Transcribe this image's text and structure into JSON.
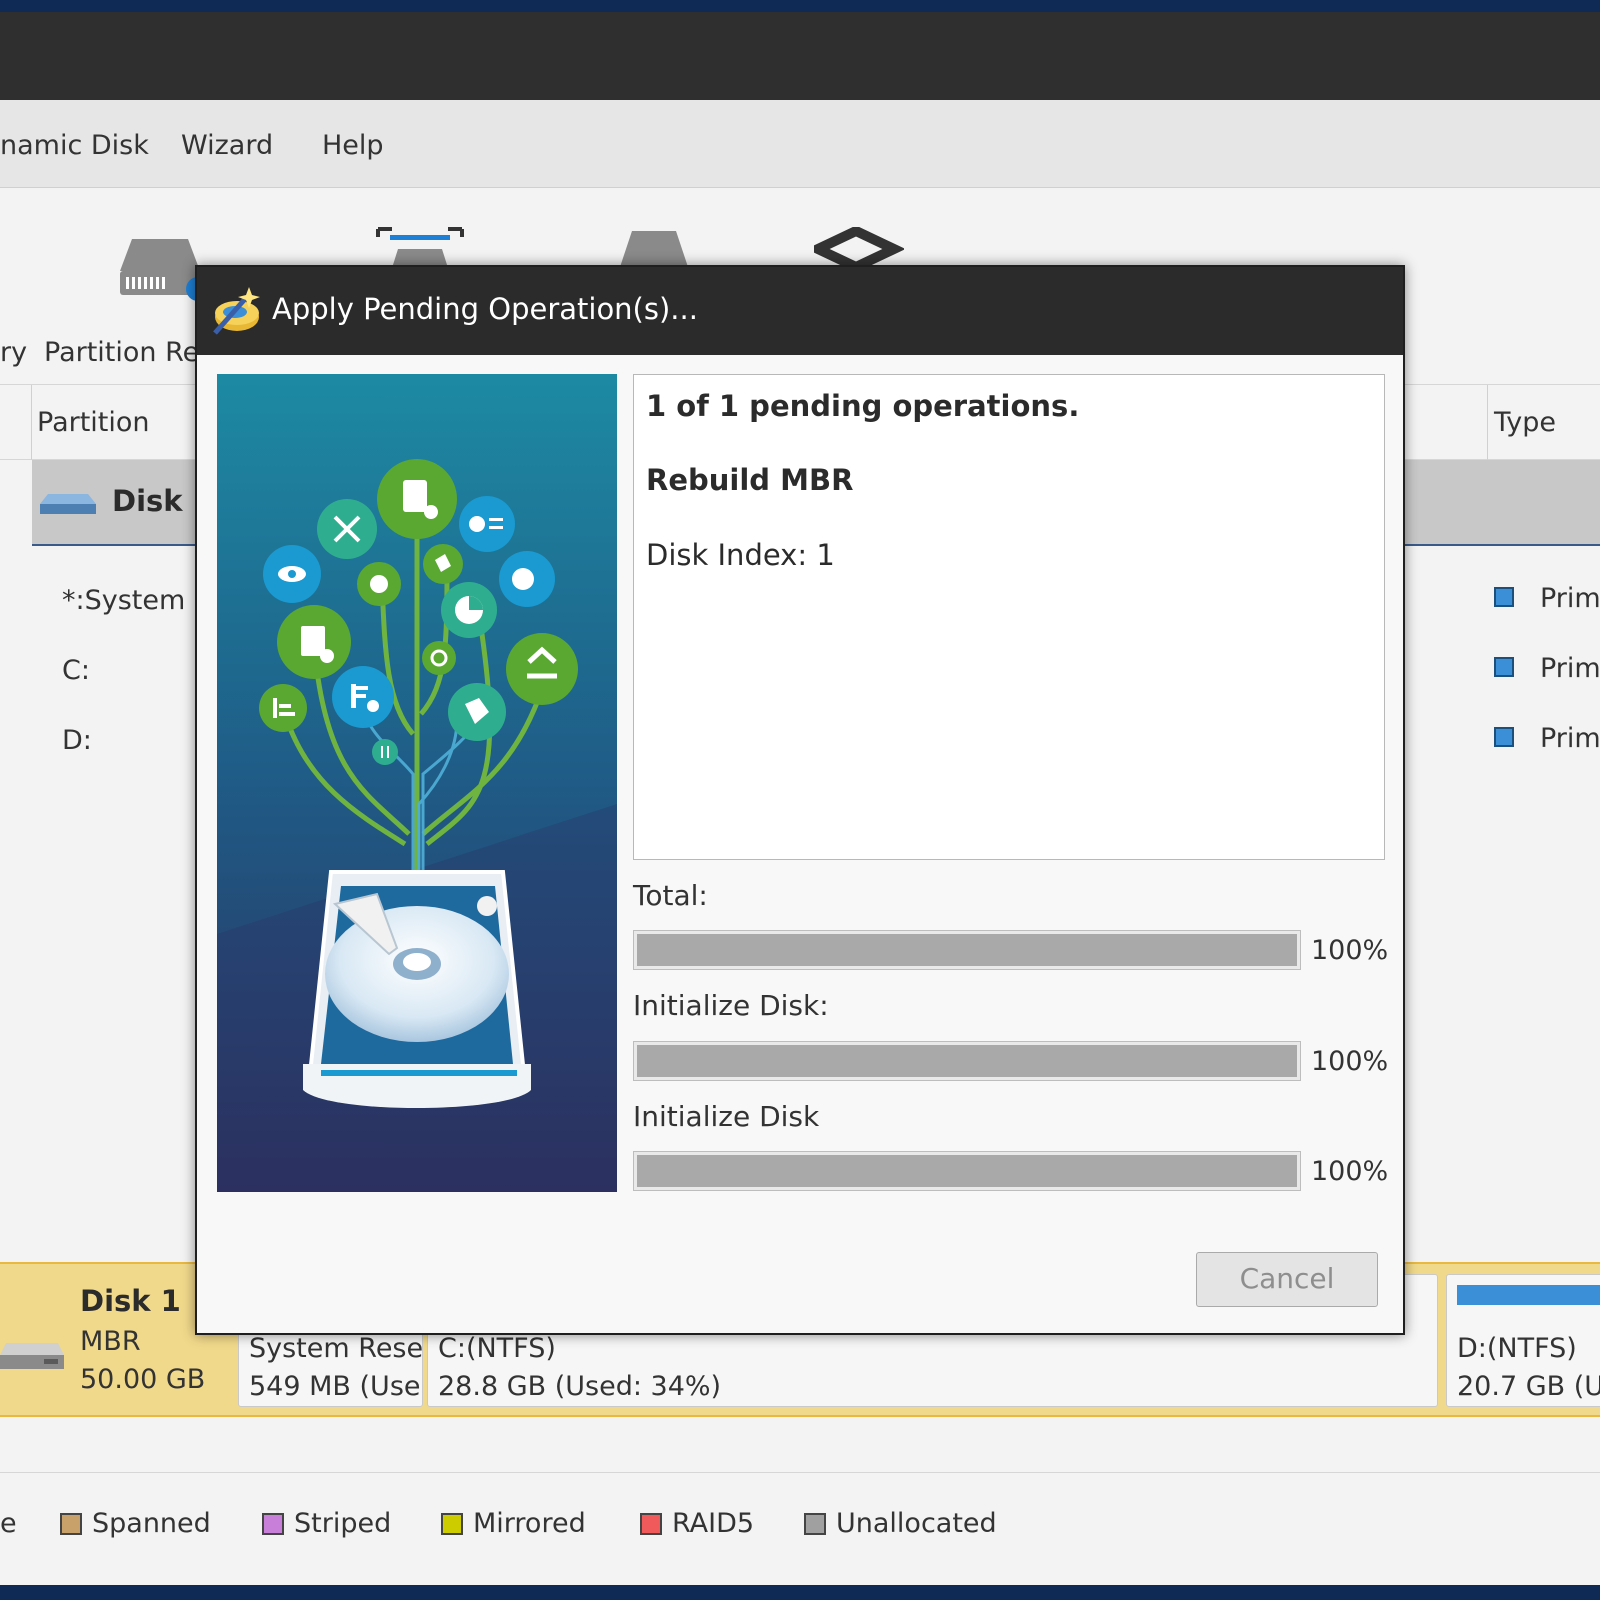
{
  "menu": {
    "items": [
      "namic Disk",
      "Wizard",
      "Help"
    ]
  },
  "toolbar": {
    "labels": [
      "ry",
      "Partition Re"
    ]
  },
  "table": {
    "headers": {
      "partition": "Partition",
      "type": "Type"
    },
    "disk_row": {
      "label": "Disk 1"
    },
    "partitions": [
      {
        "label": "*:System",
        "type": "Prim"
      },
      {
        "label": "C:",
        "type": "Prim"
      },
      {
        "label": "D:",
        "type": "Prim"
      }
    ]
  },
  "disk_map": {
    "title": "Disk 1",
    "scheme": "MBR",
    "size": "50.00 GB",
    "partitions": [
      {
        "name": "System Rese",
        "detail": "549 MB (Use",
        "used": 1.0
      },
      {
        "name": "C:(NTFS)",
        "detail": "28.8 GB (Used: 34%)",
        "used": 0.34
      },
      {
        "name": "D:(NTFS)",
        "detail": "20.7 GB (U",
        "used": 1.0
      }
    ]
  },
  "legend": {
    "items": [
      {
        "label": "e",
        "color": "#f3f3f3"
      },
      {
        "label": "Spanned",
        "color": "#c8a06a"
      },
      {
        "label": "Striped",
        "color": "#c77fd9"
      },
      {
        "label": "Mirrored",
        "color": "#cccc00"
      },
      {
        "label": "RAID5",
        "color": "#f05a5a"
      },
      {
        "label": "Unallocated",
        "color": "#a0a0a0"
      }
    ]
  },
  "dialog": {
    "title": "Apply Pending Operation(s)...",
    "summary": "1 of 1 pending operations.",
    "operation": "Rebuild MBR",
    "detail": "Disk Index: 1",
    "progress": [
      {
        "label": "Total:",
        "percent": "100%",
        "value": 1.0
      },
      {
        "label": "Initialize Disk:",
        "percent": "100%",
        "value": 1.0
      },
      {
        "label": "Initialize Disk",
        "percent": "100%",
        "value": 1.0
      }
    ],
    "cancel_label": "Cancel"
  },
  "colors": {
    "accent": "#3b8fd6",
    "disk_map_bg": "#f1d98b",
    "dialog_title_bg": "#2b2b2b"
  }
}
